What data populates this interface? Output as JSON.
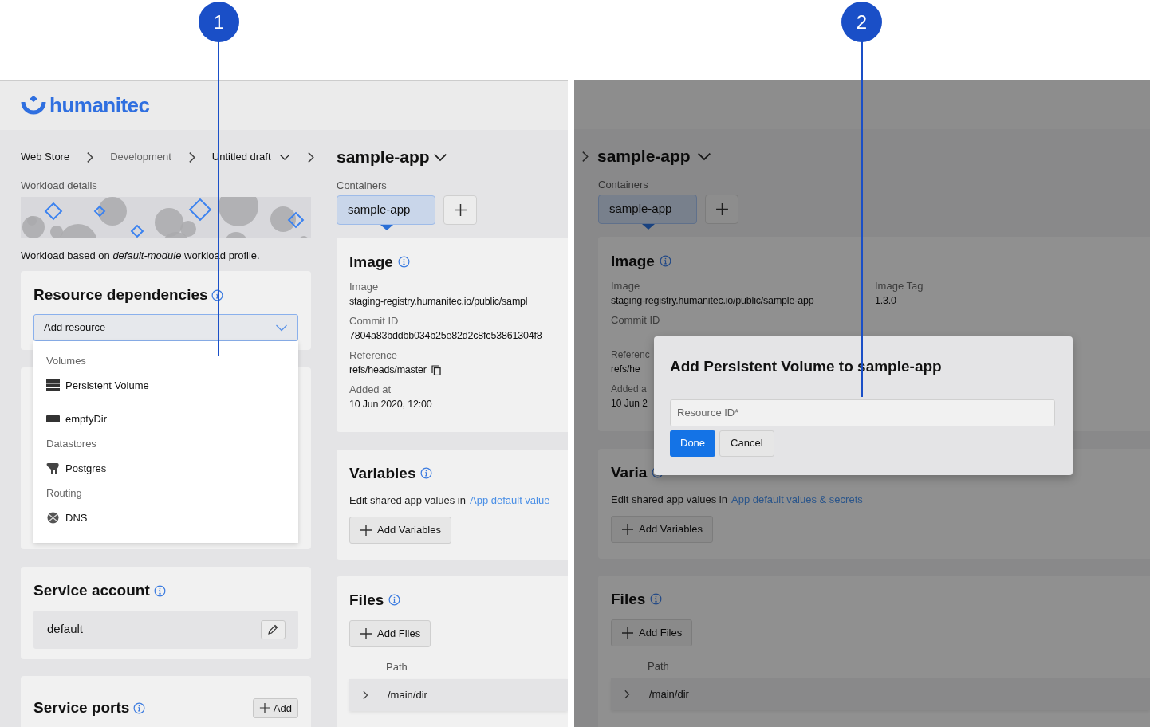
{
  "callouts": [
    {
      "number": "1"
    },
    {
      "number": "2"
    }
  ],
  "left_view": {
    "logo": "humanitec",
    "breadcrumbs": [
      {
        "label": "Web Store",
        "muted": false,
        "dropdown": false
      },
      {
        "label": "Development",
        "muted": true,
        "dropdown": false
      },
      {
        "label": "Untitled draft",
        "muted": false,
        "dropdown": true
      }
    ],
    "app_title": "sample-app",
    "workload": {
      "label": "Workload details",
      "description": "Workload based on *default-module* workload profile."
    },
    "resource_dependencies": {
      "title": "Resource dependencies",
      "select_placeholder": "Add resource",
      "menu": [
        {
          "kind": "heading",
          "label": "Volumes"
        },
        {
          "kind": "item",
          "label": "Persistent Volume"
        },
        {
          "kind": "item",
          "label": "emptyDir"
        },
        {
          "kind": "heading",
          "label": "Datastores"
        },
        {
          "kind": "item",
          "label": "Postgres"
        },
        {
          "kind": "heading",
          "label": "Routing"
        },
        {
          "kind": "item",
          "label": "DNS"
        }
      ]
    },
    "service_account": {
      "title": "Service account",
      "value": "default"
    },
    "service_ports": {
      "title": "Service ports",
      "add_button": "Add"
    },
    "containers": {
      "label": "Containers",
      "tabs": [
        {
          "label": "sample-app",
          "selected": true
        }
      ]
    },
    "image": {
      "title": "Image",
      "fields": [
        {
          "label": "Image",
          "value": "staging-registry.humanitec.io/public/sampl",
          "copy": false
        },
        {
          "label": "Commit ID",
          "value": "7804a83bddbb034b25e82d2c8fc53861304f8",
          "copy": false
        },
        {
          "label": "Reference",
          "value": "refs/heads/master",
          "copy": true
        },
        {
          "label": "Added at",
          "value": "10 Jun 2020, 12:00",
          "copy": false
        }
      ]
    },
    "variables": {
      "title": "Variables",
      "description": "Edit shared app values in",
      "link": "App default value",
      "add_button": "Add Variables"
    },
    "files": {
      "title": "Files",
      "add_button": "Add Files",
      "column": "Path",
      "rows": [
        {
          "path": "/main/dir",
          "expanded": false
        }
      ]
    }
  },
  "right_view": {
    "app_title": "sample-app",
    "containers": {
      "label": "Containers",
      "tabs": [
        {
          "label": "sample-app",
          "selected": true
        }
      ]
    },
    "image": {
      "title": "Image",
      "fields": [
        {
          "label": "Image",
          "value": "staging-registry.humanitec.io/public/sample-app"
        },
        {
          "label": "Image Tag",
          "value": "1.3.0"
        }
      ],
      "commit_label": "Commit ID",
      "partial_fields": [
        {
          "label": "Referenc",
          "value": "refs/he"
        },
        {
          "label": "Added a",
          "value": "10 Jun 2"
        }
      ]
    },
    "variables": {
      "title": "Varia",
      "description": "Edit shared app values in",
      "link": "App default values & secrets",
      "add_button": "Add Variables"
    },
    "files": {
      "title": "Files",
      "add_button": "Add Files",
      "column": "Path",
      "rows": [
        {
          "path": "/main/dir",
          "expanded": false
        }
      ]
    },
    "dialog": {
      "title": "Add Persistent Volume to sample-app",
      "placeholder": "Resource ID*",
      "buttons": [
        {
          "label": "Done",
          "primary": true
        },
        {
          "label": "Cancel",
          "primary": false
        }
      ]
    }
  }
}
